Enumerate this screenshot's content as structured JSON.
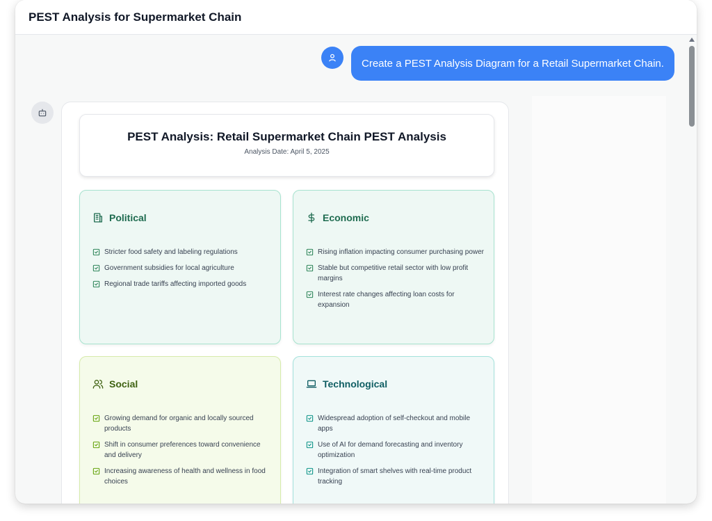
{
  "window": {
    "title": "PEST Analysis for Supermarket Chain"
  },
  "chat": {
    "user_message": "Create a PEST Analysis Diagram for a Retail Supermarket Chain."
  },
  "analysis": {
    "title": "PEST Analysis: Retail Supermarket Chain PEST Analysis",
    "date": "Analysis Date: April 5, 2025",
    "quadrants": [
      {
        "title": "Political",
        "icon": "building-icon",
        "color": "#1e6b4f",
        "items": [
          "Stricter food safety and labeling regulations",
          "Government subsidies for local agriculture",
          "Regional trade tariffs affecting imported goods"
        ]
      },
      {
        "title": "Economic",
        "icon": "dollar-icon",
        "color": "#1e6b4f",
        "items": [
          "Rising inflation impacting consumer purchasing power",
          "Stable but competitive retail sector with low profit margins",
          "Interest rate changes affecting loan costs for expansion"
        ]
      },
      {
        "title": "Social",
        "icon": "users-icon",
        "color": "#3f6212",
        "items": [
          "Growing demand for organic and locally sourced products",
          "Shift in consumer preferences toward convenience and delivery",
          "Increasing awareness of health and wellness in food choices"
        ]
      },
      {
        "title": "Technological",
        "icon": "laptop-icon",
        "color": "#0f5e63",
        "items": [
          "Widespread adoption of self-checkout and mobile apps",
          "Use of AI for demand forecasting and inventory optimization",
          "Integration of smart shelves with real-time product tracking"
        ]
      }
    ]
  }
}
